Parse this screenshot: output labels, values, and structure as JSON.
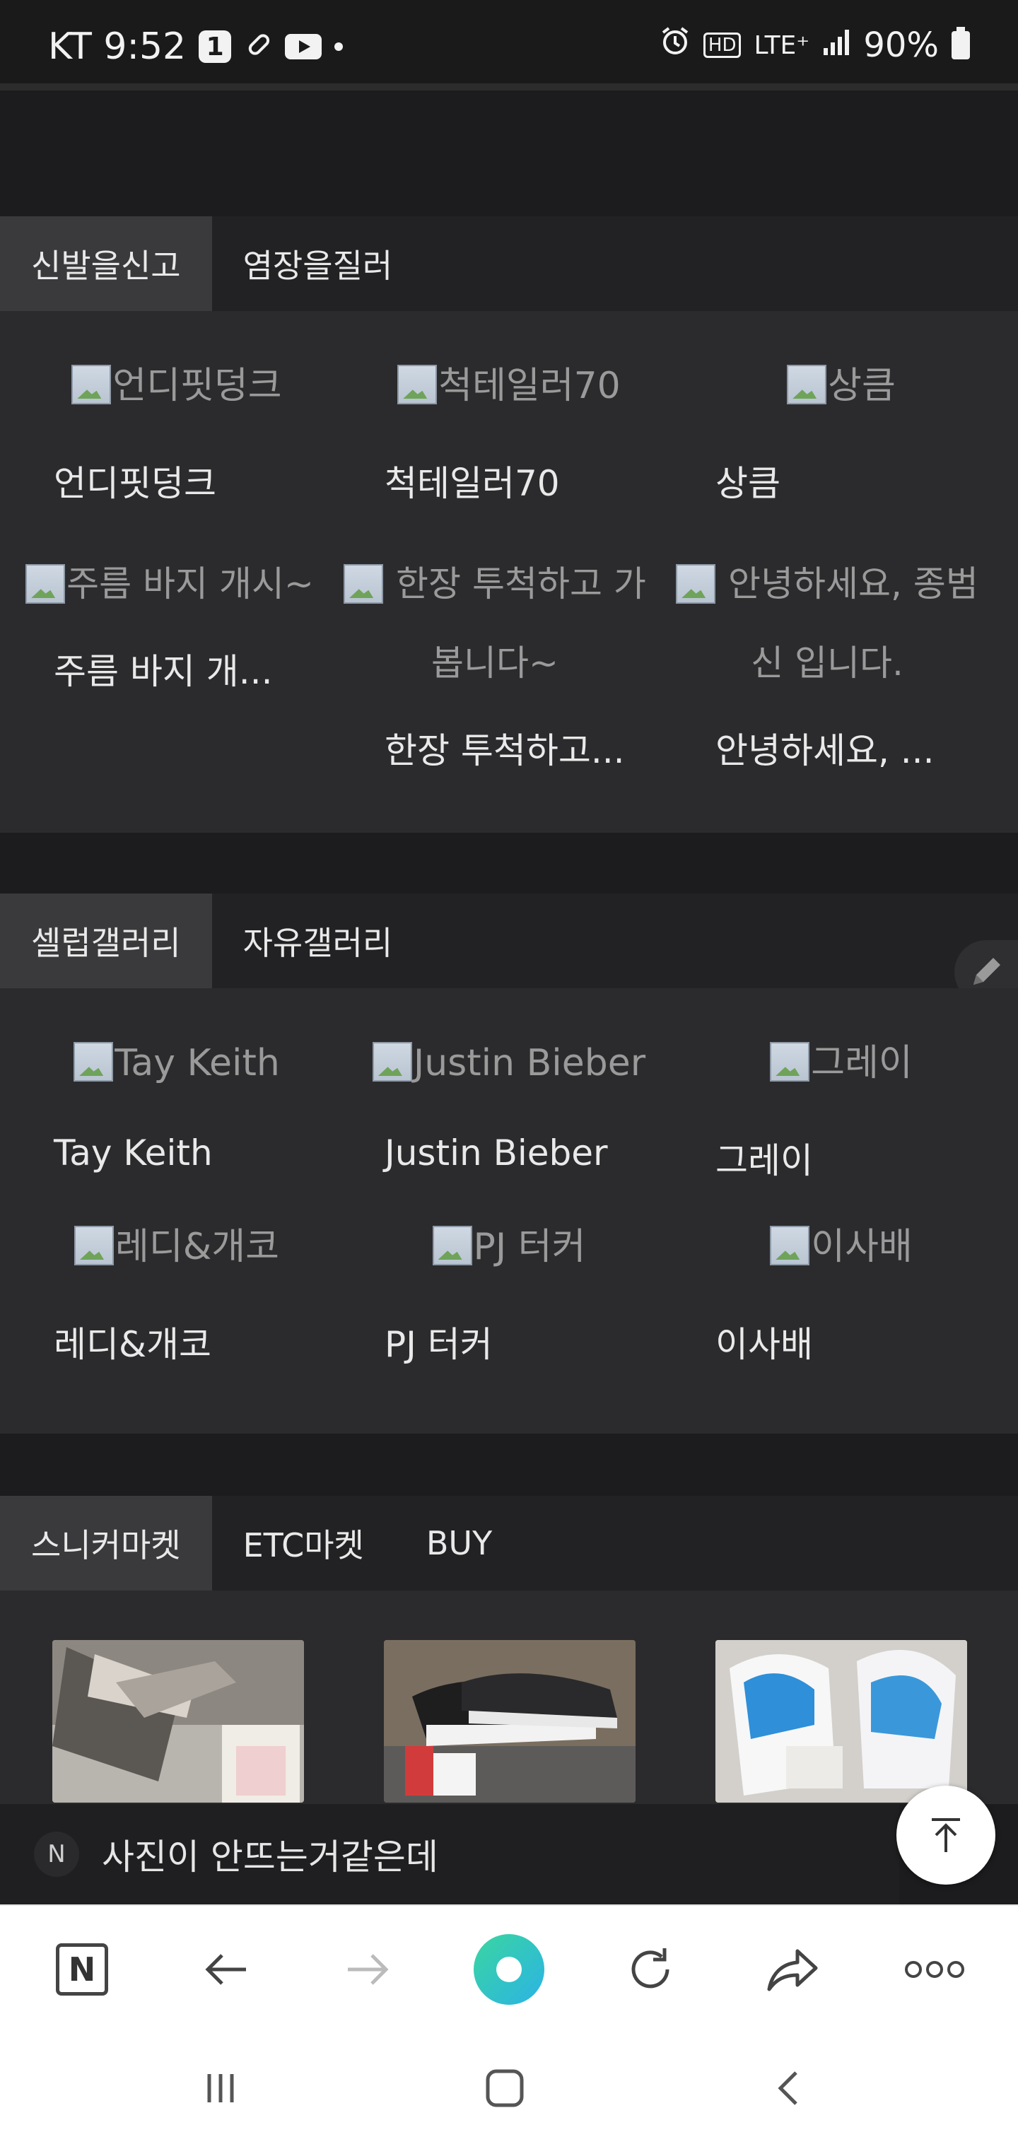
{
  "status_bar": {
    "carrier_time": "KT 9:52",
    "notif_count": "1",
    "network": "LTE⁺",
    "battery": "90%"
  },
  "section1": {
    "tabs": [
      "신발을신고",
      "염장을질러"
    ],
    "row1": [
      {
        "alt": "언디핏덩크",
        "caption": "언디핏덩크"
      },
      {
        "alt": "척테일러70",
        "caption": "척테일러70"
      },
      {
        "alt": "상큼",
        "caption": "상큼"
      }
    ],
    "row2": [
      {
        "alt_lines": [
          "주름 바지 개시~"
        ],
        "caption": "주름 바지 개..."
      },
      {
        "alt_lines": [
          "한장 투척하고 가",
          "봅니다~"
        ],
        "caption": "한장 투척하고..."
      },
      {
        "alt_lines": [
          "안녕하세요, 종범",
          "신 입니다."
        ],
        "caption": "안녕하세요, ..."
      }
    ]
  },
  "section2": {
    "tabs": [
      "셀럽갤러리",
      "자유갤러리"
    ],
    "row1": [
      {
        "alt": "Tay Keith",
        "caption": "Tay Keith"
      },
      {
        "alt": "Justin Bieber",
        "caption": "Justin Bieber"
      },
      {
        "alt": "그레이",
        "caption": "그레이"
      }
    ],
    "row2": [
      {
        "alt": "레디&개코",
        "caption": "레디&개코"
      },
      {
        "alt": "PJ 터커",
        "caption": "PJ 터커"
      },
      {
        "alt": "이사배",
        "caption": "이사배"
      }
    ]
  },
  "section3": {
    "tabs": [
      "스니커마켓",
      "ETC마켓",
      "BUY"
    ]
  },
  "comment_bar": {
    "badge": "N",
    "text": "사진이 안뜨는거같은데"
  },
  "toolbar": {
    "home_label": "N"
  },
  "colors": {
    "background": "#1c1c1e",
    "panel": "#2b2b2d",
    "active_tab": "#3a3a3c",
    "accent_gradient": [
      "#3ad6a0",
      "#2bb3e6"
    ]
  }
}
